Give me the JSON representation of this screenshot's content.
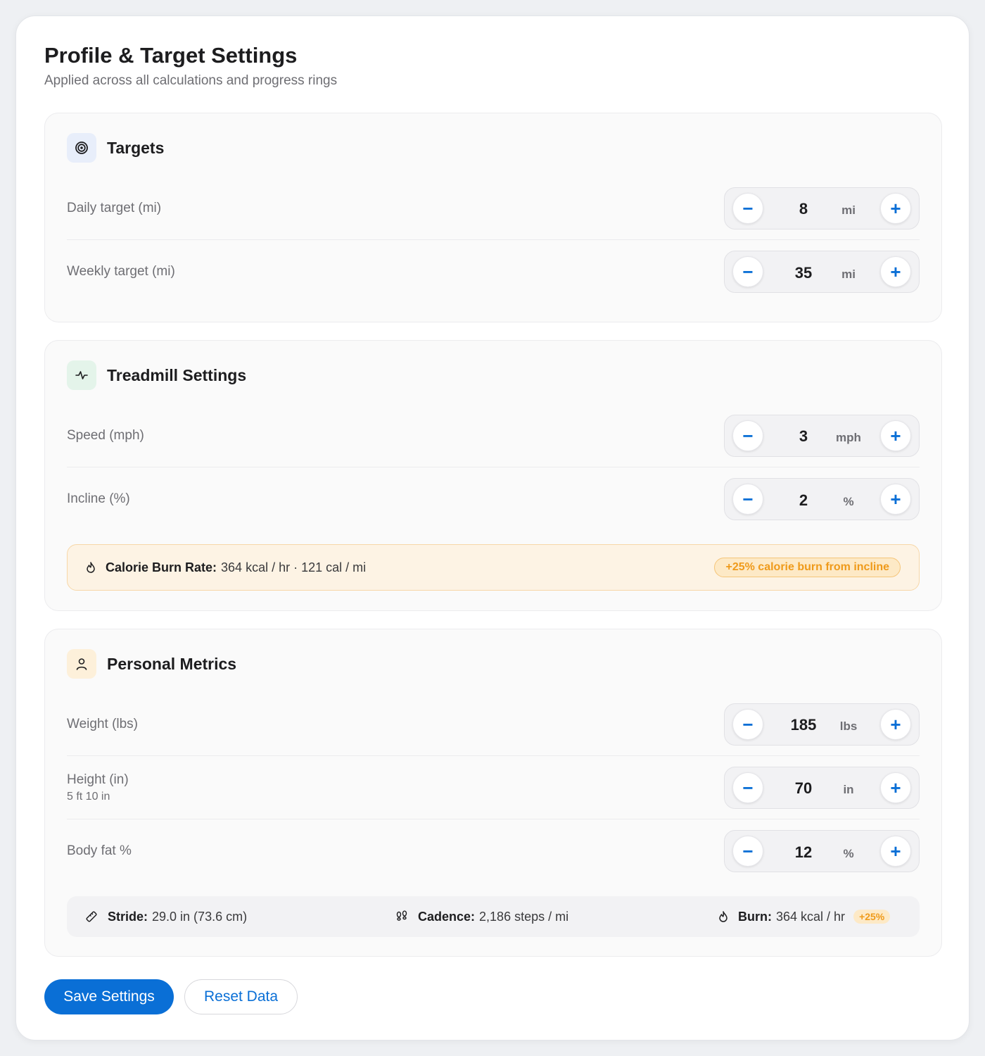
{
  "header": {
    "title": "Profile & Target Settings",
    "subtitle": "Applied across all calculations and progress rings"
  },
  "colors": {
    "accent": "#0a6fd6",
    "warning": "#ef9a1a",
    "targets_icon_bg": "#e8eefa",
    "treadmill_icon_bg": "#e4f4ea",
    "personal_icon_bg": "#fdf0da"
  },
  "targets": {
    "title": "Targets",
    "icon": "target-icon",
    "rows": [
      {
        "label": "Daily target (mi)",
        "value": "8",
        "unit": "mi"
      },
      {
        "label": "Weekly target (mi)",
        "value": "35",
        "unit": "mi"
      }
    ]
  },
  "treadmill": {
    "title": "Treadmill Settings",
    "icon": "activity-icon",
    "rows": [
      {
        "label": "Speed (mph)",
        "value": "3",
        "unit": "mph"
      },
      {
        "label": "Incline (%)",
        "value": "2",
        "unit": "%"
      }
    ],
    "burn": {
      "icon": "flame-icon",
      "label": "Calorie Burn Rate:",
      "value": "364 kcal / hr · 121 cal / mi",
      "badge": "+25% calorie burn from incline"
    }
  },
  "personal": {
    "title": "Personal Metrics",
    "icon": "user-icon",
    "rows": [
      {
        "label": "Weight (lbs)",
        "value": "185",
        "unit": "lbs"
      },
      {
        "label": "Height (in)",
        "sublabel": "5 ft 10 in",
        "value": "70",
        "unit": "in"
      },
      {
        "label": "Body fat %",
        "value": "12",
        "unit": "%"
      }
    ],
    "summary": {
      "stride_label": "Stride:",
      "stride_value": "29.0 in (73.6 cm)",
      "cadence_label": "Cadence:",
      "cadence_value": "2,186 steps / mi",
      "burn_label": "Burn:",
      "burn_value": "364 kcal / hr",
      "burn_badge": "+25%"
    }
  },
  "stepper": {
    "minus": "−",
    "plus": "+"
  },
  "actions": {
    "save": "Save Settings",
    "reset": "Reset Data"
  }
}
